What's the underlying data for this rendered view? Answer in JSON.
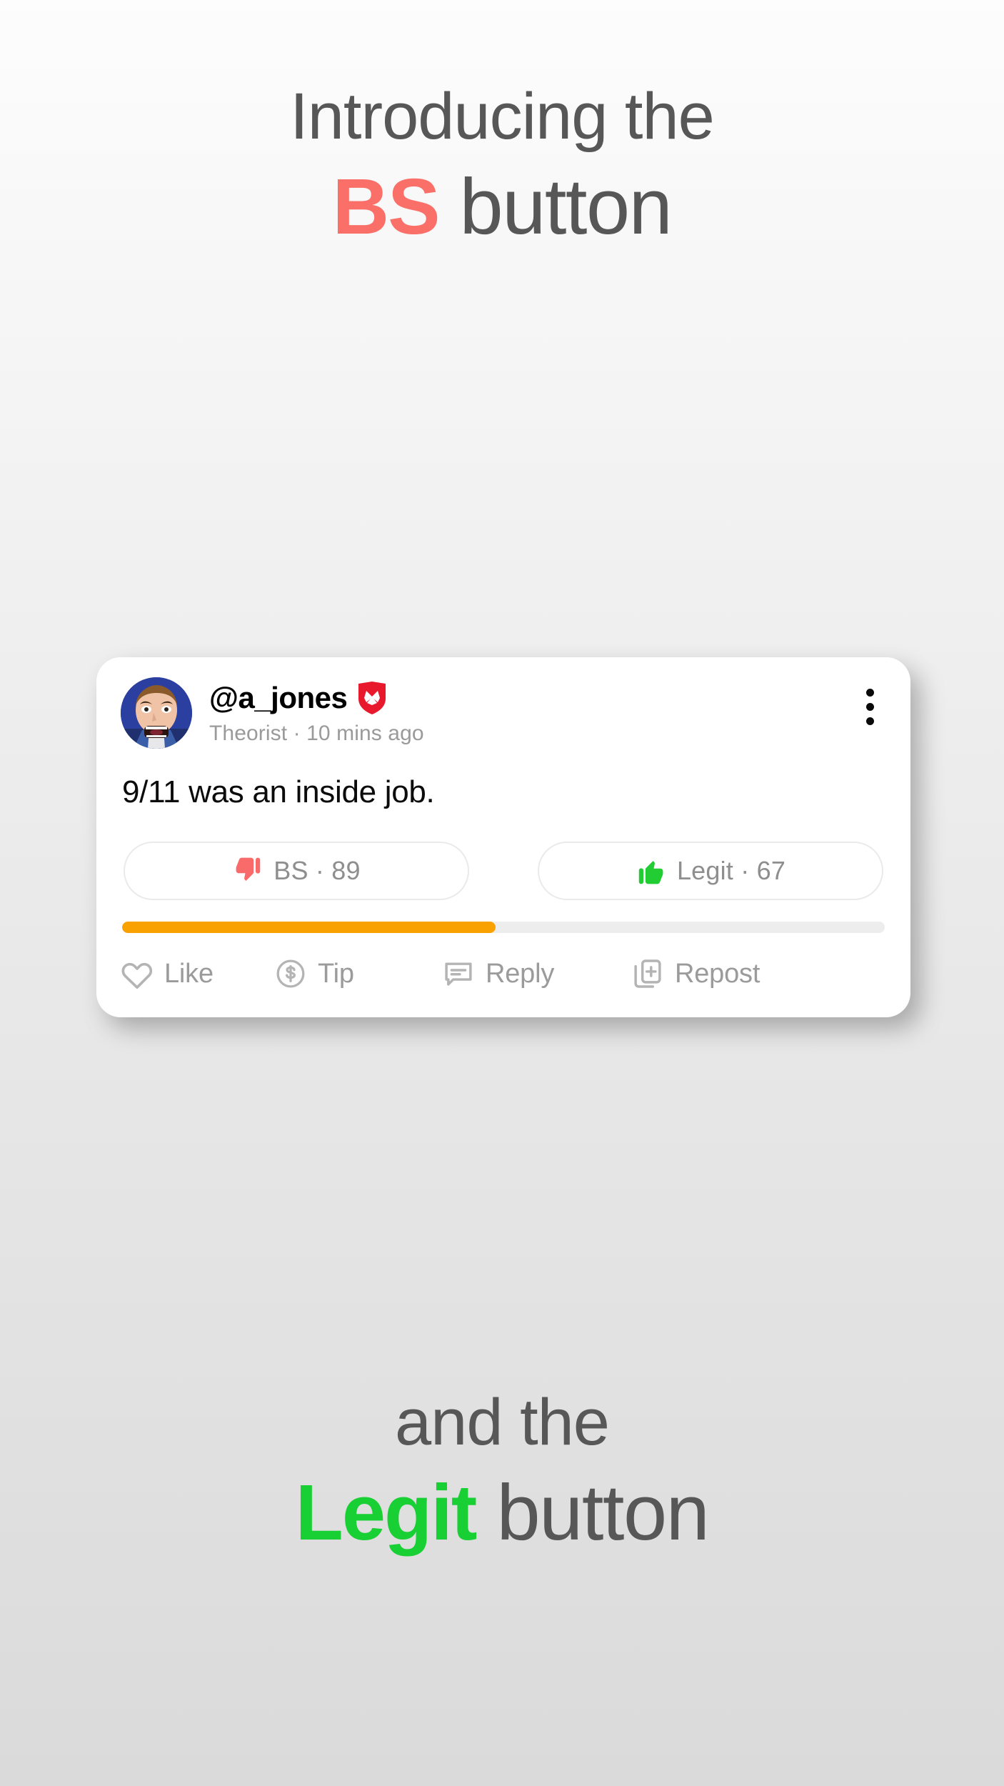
{
  "headline_top": {
    "line1": "Introducing the",
    "accent": "BS",
    "rest": " button"
  },
  "headline_bottom": {
    "line1": "and the",
    "accent": "Legit",
    "rest": " button"
  },
  "colors": {
    "bs_accent": "#FA7068",
    "legit_accent": "#18CF34",
    "headline_gray": "#575757",
    "progress_fill": "#F9A100",
    "progress_track": "#EDEDED",
    "badge_red": "#E8192C",
    "thumbs_down_red": "#F96B6B",
    "thumbs_up_green": "#22CC33",
    "muted_text": "#9B9B9B"
  },
  "post": {
    "avatar_alt": "angry-cartoon-man-avatar",
    "handle": "@a_jones",
    "verified_badge_icon": "red-shield-maltese-cross-icon",
    "meta": "Theorist · 10 mins ago",
    "more_menu_icon": "vertical-dots-icon",
    "text": "9/11 was an inside job.",
    "vote": {
      "bs": {
        "icon": "thumbs-down-icon",
        "label": "BS · 89",
        "count": 89
      },
      "legit": {
        "icon": "thumbs-up-icon",
        "label": "Legit · 67",
        "count": 67
      }
    },
    "progress": {
      "fill_percent": 49
    },
    "actions": [
      {
        "icon": "heart-icon",
        "label": "Like"
      },
      {
        "icon": "dollar-circle-icon",
        "label": "Tip"
      },
      {
        "icon": "speech-bubble-icon",
        "label": "Reply"
      },
      {
        "icon": "repost-pages-plus-icon",
        "label": "Repost"
      }
    ]
  }
}
